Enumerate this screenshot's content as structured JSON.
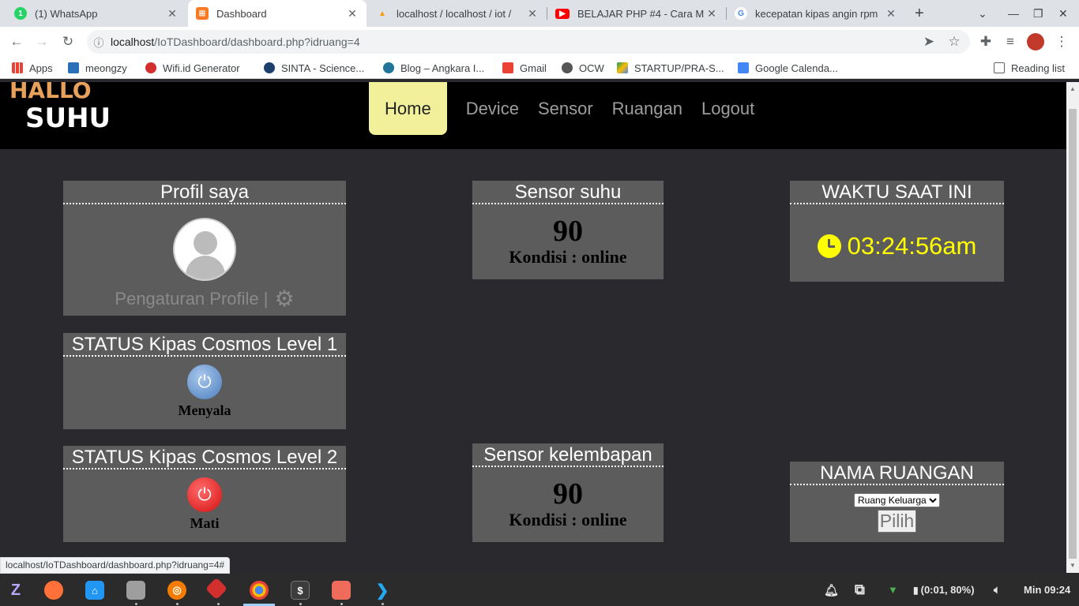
{
  "browser": {
    "tabs": [
      {
        "title": "(1) WhatsApp",
        "icon": "whatsapp-icon",
        "color": "#25d366",
        "glyph": "1"
      },
      {
        "title": "Dashboard",
        "icon": "xampp-icon",
        "color": "#fb7a24",
        "glyph": "⊞"
      },
      {
        "title": "localhost / localhost / iot /",
        "icon": "phpmyadmin-icon",
        "color": "#f89c0e",
        "glyph": "▲"
      },
      {
        "title": "BELAJAR PHP #4 - Cara M",
        "icon": "youtube-icon",
        "color": "#ff0000",
        "glyph": "▶"
      },
      {
        "title": "kecepatan kipas angin rpm",
        "icon": "google-icon",
        "color": "#4285f4",
        "glyph": "G"
      }
    ],
    "new_tab": "+",
    "url_host": "localhost",
    "url_path": "/IoTDashboard/dashboard.php?idruang=4",
    "bookmarks": [
      {
        "label": "Apps",
        "color": "#4285f4"
      },
      {
        "label": "meongzy",
        "color": "#2a6fb7"
      },
      {
        "label": "Wifi.id Generator",
        "color": "#d32f2f"
      },
      {
        "label": "SINTA - Science...",
        "color": "#1c3f6e"
      },
      {
        "label": "Blog – Angkara I...",
        "color": "#21759b"
      },
      {
        "label": "Gmail",
        "color": "#ea4335"
      },
      {
        "label": "OCW",
        "color": "#555555"
      },
      {
        "label": "STARTUP/PRA-S...",
        "color": "#0f9d58"
      },
      {
        "label": "Google Calenda...",
        "color": "#4285f4"
      }
    ],
    "reading_list": "Reading list",
    "status_url": "localhost/IoTDashboard/dashboard.php?idruang=4#"
  },
  "site": {
    "logo_top": "HALLO",
    "logo_bottom": "SUHU",
    "nav": {
      "home": "Home",
      "device": "Device",
      "sensor": "Sensor",
      "ruangan": "Ruangan",
      "logout": "Logout"
    }
  },
  "profile": {
    "title": "Profil saya",
    "link": "Pengaturan Profile |"
  },
  "temp_sensor": {
    "title": "Sensor suhu",
    "value": "90",
    "condition": "Kondisi : online"
  },
  "time": {
    "title": "WAKTU SAAT INI",
    "value": "03:24:56am"
  },
  "fan1": {
    "title": "STATUS Kipas Cosmos Level 1",
    "state": "Menyala"
  },
  "fan2": {
    "title": "STATUS Kipas Cosmos Level 2",
    "state": "Mati"
  },
  "humidity_sensor": {
    "title": "Sensor kelembapan",
    "value": "90",
    "condition": "Kondisi : online"
  },
  "room": {
    "title": "NAMA RUANGAN",
    "selected": "Ruang Keluarga",
    "button": "Pilih"
  },
  "taskbar": {
    "status": "(0:01, 80%)",
    "clock": "Min 09:24"
  }
}
